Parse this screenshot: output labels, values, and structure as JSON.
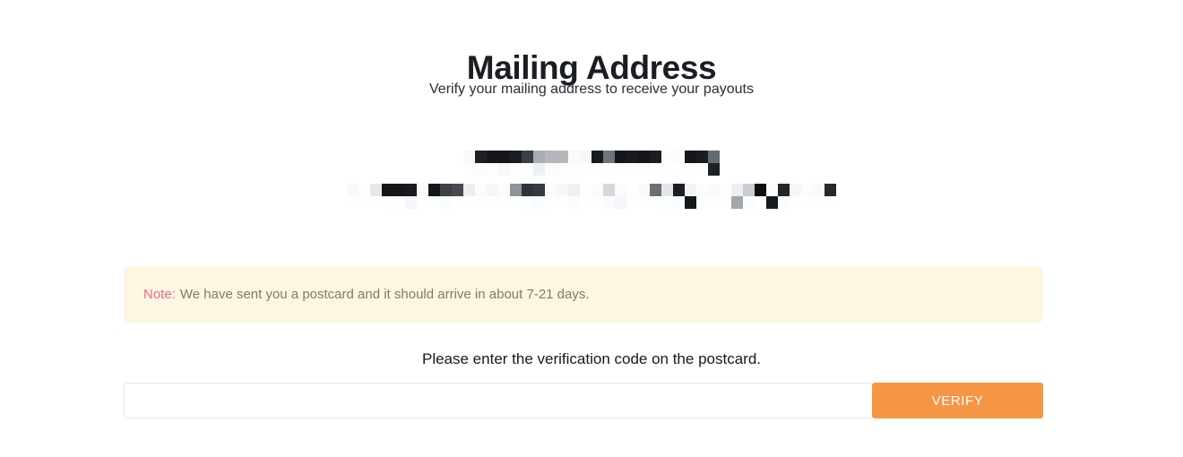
{
  "page": {
    "title": "Mailing Address",
    "subtitle": "Verify your mailing address to receive your payouts",
    "background_color": "#ffffff"
  },
  "address": {
    "redacted": true,
    "description": "Mailing address obscured by pixelation mosaic",
    "lines": [
      {
        "name": "recipient-name-line",
        "redacted_text": "",
        "mosaic": [
          [
            "#f7f9fb",
            "#fcfdfe"
          ],
          [
            "#1d2024",
            "#fbfcfd"
          ],
          [
            "#15181b",
            "#fdfdfe"
          ],
          [
            "#14171a",
            "#f6f8fa"
          ],
          [
            "#1b1e22",
            "#fcfdfe"
          ],
          [
            "#3b3f44",
            "#fdfefe"
          ],
          [
            "#a9adb2",
            "#eef1f4"
          ],
          [
            "#b3b7bb",
            "#fbfcfd"
          ],
          [
            "#b4b8bc",
            "#fdfdfe"
          ],
          [
            "#fafbfc",
            "#fdfefe"
          ],
          [
            "#f5f8fa",
            "#fefefe"
          ],
          [
            "#181b1e",
            "#fcfdfe"
          ],
          [
            "#6f757b",
            "#fdfdfe"
          ],
          [
            "#15181b",
            "#fdfefe"
          ],
          [
            "#181b1f",
            "#fefefe"
          ],
          [
            "#14171a",
            "#fdfdfe"
          ],
          [
            "#1a1d21",
            "#fdfefe"
          ],
          [
            "#fbfcfd",
            "#fefefe"
          ],
          [
            "#f9fbfc",
            "#fefefe"
          ],
          [
            "#15181b",
            "#fcfdfe"
          ],
          [
            "#191c20",
            "#fdfefe"
          ],
          [
            "#636a70",
            "#1d2024"
          ]
        ]
      },
      {
        "name": "street-address-line",
        "redacted_text": "",
        "mosaic": [
          [
            "#f7f9fb",
            "#fdfefe"
          ],
          [
            "#fcfdfe",
            "#fefefe"
          ],
          [
            "#e6e9ec",
            "#fdfefe"
          ],
          [
            "#131619",
            "#fcfdfe"
          ],
          [
            "#15181b",
            "#fdfdfe"
          ],
          [
            "#181b1f",
            "#f4f6f8"
          ],
          [
            "#fcf9f7",
            "#fefefe"
          ],
          [
            "#14171a",
            "#fdfefe"
          ],
          [
            "#3d4146",
            "#fbfcfd"
          ],
          [
            "#474b50",
            "#fdfefe"
          ],
          [
            "#eceef1",
            "#fefefe"
          ],
          [
            "#fbfcfd",
            "#fefefe"
          ],
          [
            "#f5f7fa",
            "#fefefe"
          ],
          [
            "#fafcfd",
            "#fefefe"
          ],
          [
            "#8d9398",
            "#fdfefe"
          ],
          [
            "#2f3338",
            "#fcfdfe"
          ],
          [
            "#353940",
            "#fafbfc"
          ],
          [
            "#fbfcfd",
            "#fefefe"
          ],
          [
            "#f6f8fa",
            "#fdfefe"
          ],
          [
            "#eef0f3",
            "#fbfcfd"
          ],
          [
            "#fcfdfe",
            "#fefefe"
          ],
          [
            "#fafbfd",
            "#fefefe"
          ],
          [
            "#d6d9dc",
            "#fafbfc"
          ],
          [
            "#fafbfc",
            "#f5f7fa"
          ],
          [
            "#fdfefe",
            "#fefefe"
          ],
          [
            "#f9fafc",
            "#fefefe"
          ],
          [
            "#6a7076",
            "#fdfefe"
          ],
          [
            "#e4e7ea",
            "#fcfdfe"
          ],
          [
            "#1b1e22",
            "#fbfcfd"
          ],
          [
            "#f0f2f5",
            "#15181b"
          ],
          [
            "#fbfcfd",
            "#fdfefe"
          ],
          [
            "#f8fafb",
            "#fdfefe"
          ],
          [
            "#fcfdfe",
            "#fefefe"
          ],
          [
            "#eceff2",
            "#a2a7ab"
          ],
          [
            "#c9cdd1",
            "#fbfcfd"
          ],
          [
            "#0e1114",
            "#fdfefe"
          ],
          [
            "#fbfcfd",
            "#171a1d"
          ],
          [
            "#23272b",
            "#fafbfc"
          ],
          [
            "#f5f7f9",
            "#fdfefe"
          ],
          [
            "#fbfcfd",
            "#fefefe"
          ],
          [
            "#f7f9fb",
            "#fdfefe"
          ],
          [
            "#262a2e",
            "#fdfefe"
          ]
        ]
      }
    ]
  },
  "note": {
    "label": "Note:",
    "text": "We have sent you a postcard and it should arrive in about 7-21 days.",
    "label_color": "#f2687d",
    "text_color": "#8a7b52",
    "background_color": "#fdf6e3"
  },
  "verification": {
    "prompt": "Please enter the verification code on the postcard.",
    "input_value": "",
    "input_placeholder": "",
    "button_label": "VERIFY",
    "button_color": "#f79546",
    "button_text_color": "#ffffff"
  }
}
